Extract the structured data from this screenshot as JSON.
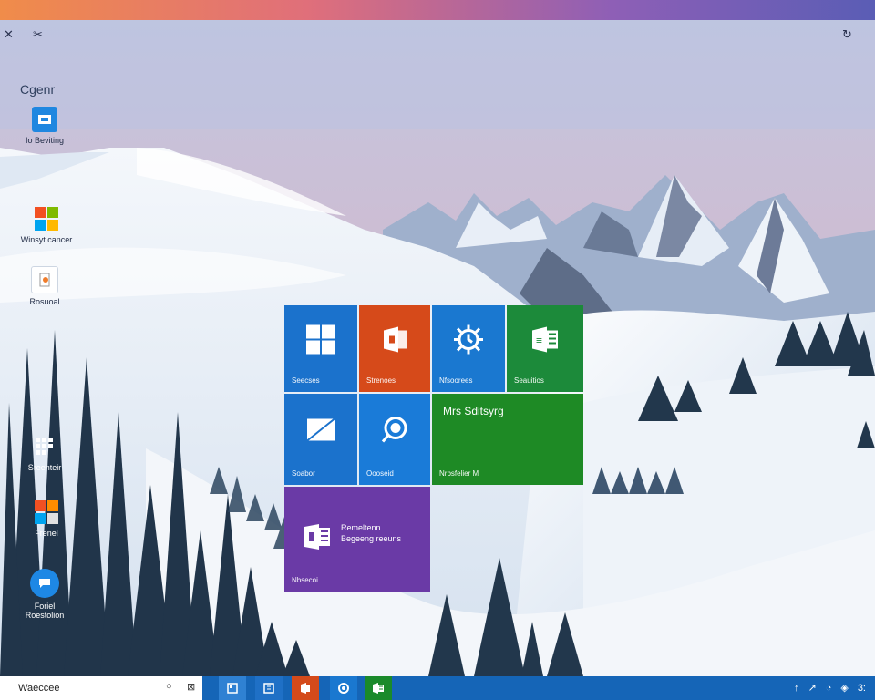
{
  "desktop": {
    "top_left_icons": [
      "✕",
      "✂"
    ],
    "top_right_icon": "↻",
    "header_label": "Cgenr",
    "icons": [
      {
        "name": "desktop-icon-file-manager",
        "label": "Io Beviting",
        "label2": ""
      },
      {
        "name": "desktop-icon-store",
        "label": "Winsyt cancer",
        "label2": ""
      },
      {
        "name": "desktop-icon-notes",
        "label": "Rosuoal",
        "label2": ""
      },
      {
        "name": "desktop-icon-apps",
        "label": "Sreenteir",
        "label2": ""
      },
      {
        "name": "desktop-icon-office",
        "label": "Frenel",
        "label2": ""
      },
      {
        "name": "desktop-icon-browser",
        "label": "Foriel",
        "label2": "Roestolion"
      }
    ]
  },
  "start_tiles": [
    {
      "name": "tile-windows",
      "label": "Seecses",
      "color": "#1b72cc",
      "icon": "windows-logo-icon"
    },
    {
      "name": "tile-office",
      "label": "Strenoes",
      "color": "#d64a1a",
      "icon": "office-icon"
    },
    {
      "name": "tile-settings",
      "label": "Nfsoorees",
      "color": "#1a78d0",
      "icon": "gear-icon"
    },
    {
      "name": "tile-excel",
      "label": "Seauitios",
      "color": "#1c8a3a",
      "icon": "excel-icon"
    },
    {
      "name": "tile-mail",
      "label": "Soabor",
      "color": "#1b72cc",
      "icon": "mail-icon"
    },
    {
      "name": "tile-search",
      "label": "Oooseid",
      "color": "#1a7bd8",
      "icon": "search-icon"
    },
    {
      "name": "tile-wide-green",
      "label": "Nrbsfelier M",
      "title": "Mrs Sditsyrg",
      "color": "#1e8a25",
      "icon": ""
    },
    {
      "name": "tile-onenote",
      "label": "Nbsecoi",
      "line1": "Remeltenn",
      "line2": "Begeeng reeuns",
      "color": "#6a3aa6",
      "icon": "onenote-icon"
    }
  ],
  "taskbar": {
    "search_text": "Waeccee",
    "search_icons": [
      "○",
      "⊠"
    ],
    "buttons": [
      {
        "name": "taskbar-app-1",
        "color": "#2f81d3"
      },
      {
        "name": "taskbar-app-2",
        "color": "#1f70c6"
      },
      {
        "name": "taskbar-app-office",
        "color": "#d44a1a"
      },
      {
        "name": "taskbar-app-settings",
        "color": "#1a78d0"
      },
      {
        "name": "taskbar-app-excel",
        "color": "#1a8a2b"
      }
    ],
    "tray": [
      "↑",
      "↗",
      "◔",
      "◈",
      "3:"
    ]
  }
}
